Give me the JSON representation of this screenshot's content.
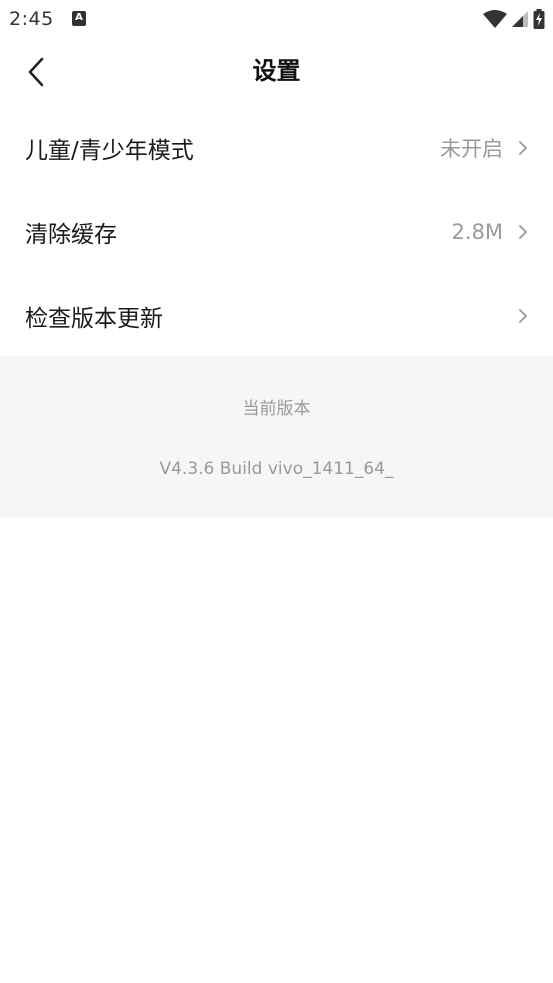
{
  "status_bar": {
    "time": "2:45",
    "notification_icon": "a-letter-icon",
    "icons": [
      "wifi-icon",
      "cell-signal-icon",
      "battery-charging-icon"
    ]
  },
  "nav": {
    "title": "设置",
    "back_icon": "chevron-left-icon"
  },
  "settings": {
    "items": [
      {
        "label": "儿童/青少年模式",
        "value": "未开启"
      },
      {
        "label": "清除缓存",
        "value": "2.8M"
      },
      {
        "label": "检查版本更新",
        "value": ""
      }
    ]
  },
  "version": {
    "caption": "当前版本",
    "number": "V4.3.6 Build vivo_1411_64_"
  },
  "colors": {
    "background": "#ffffff",
    "section_background": "#f6f6f6",
    "secondary_text": "#9a9a9a",
    "primary_text": "#1a1a1a"
  }
}
